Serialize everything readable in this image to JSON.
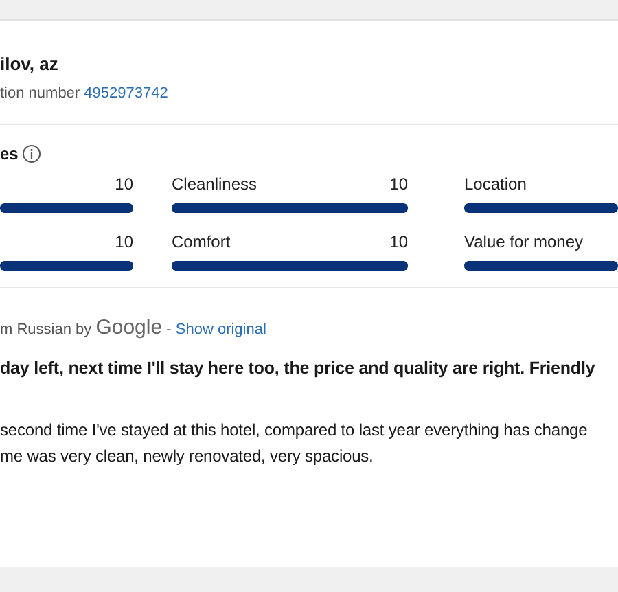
{
  "reviewer": {
    "name": "ilov, az",
    "reservation_label": "tion number",
    "reservation_number": "4952973742"
  },
  "ratings_section": {
    "title": "es",
    "items": [
      {
        "score": "10",
        "level": 1
      },
      {
        "label": "Cleanliness",
        "score": "10",
        "level": 1
      },
      {
        "label": "Location",
        "level": 1
      },
      {
        "score": "10",
        "level": 1
      },
      {
        "label": "Comfort",
        "score": "10",
        "level": 1
      },
      {
        "label": "Value for money",
        "level": 1
      }
    ]
  },
  "translation": {
    "prefix": "m Russian by",
    "provider": "Google",
    "separator": "-",
    "link": "Show original"
  },
  "review": {
    "title": "day left, next time I'll stay here too, the price and quality are right. Friendly",
    "lines": [
      "second time I've stayed at this hotel, compared to last year everything has change",
      "me was very clean, newly renovated, very spacious."
    ]
  }
}
